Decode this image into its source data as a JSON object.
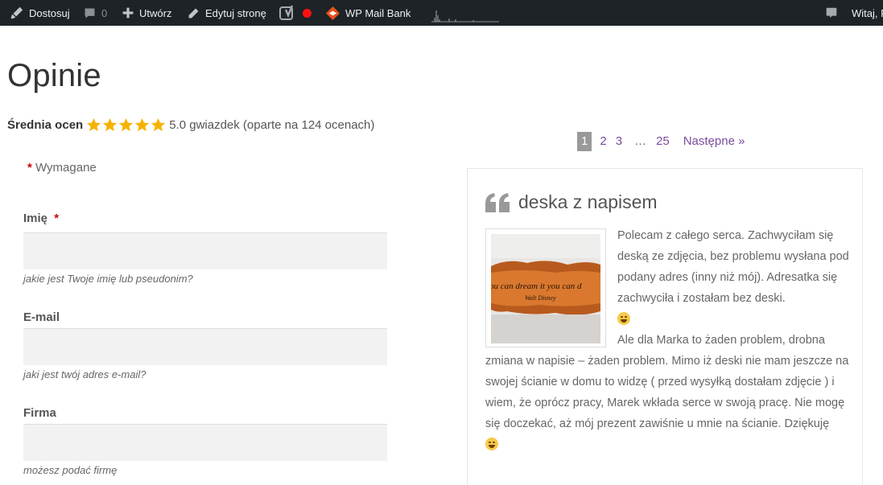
{
  "adminbar": {
    "customize_label": "Dostosuj",
    "comments_count": "0",
    "new_label": "Utwórz",
    "edit_label": "Edytuj stronę",
    "plugin_label": "WP Mail Bank",
    "greeting": "Witaj, F"
  },
  "page": {
    "title": "Opinie",
    "rating_label": "Średnia ocen",
    "rating_value": 5.0,
    "rating_summary": "5.0 gwiazdek (oparte na 124 ocenach)"
  },
  "form": {
    "required_marker": "*",
    "required_label": "Wymagane",
    "fields": [
      {
        "label": "Imię",
        "required": true,
        "value": "",
        "help": "jakie jest Twoje imię lub pseudonim?"
      },
      {
        "label": "E-mail",
        "required": false,
        "value": "",
        "help": "jaki jest twój adres e-mail?"
      },
      {
        "label": "Firma",
        "required": false,
        "value": "",
        "help": "możesz podać firmę"
      }
    ]
  },
  "pagination": {
    "current": "1",
    "pages": [
      "2",
      "3"
    ],
    "ellipsis": "…",
    "last": "25",
    "next": "Następne »"
  },
  "review": {
    "title": "deska z napisem",
    "image_text": "ou can dream it you can d",
    "paragraph1": "Polecam z całego serca. Zachwyciłam się deską ze zdjęcia, bez problemu wysłana pod podany adres (inny niż mój). Adresatka się zachwyciła i zostałam bez deski.",
    "paragraph2": "Ale dla Marka to żaden problem, drobna zmiana w napisie – żaden problem. Mimo iż deski nie mam jeszcze na swojej ścianie w domu to widzę ( przed wysyłką dostałam zdjęcie ) i wiem, że oprócz pracy, Marek wkłada serce w swoją pracę. Nie mogę się doczekać, aż mój prezent zawiśnie u mnie na ścianie. Dziękuję"
  },
  "colors": {
    "adminbar_bg": "#1d2327",
    "star": "#f5b301",
    "link": "#7b4d9c",
    "required": "#cc0000",
    "record_dot": "#ff1111",
    "plugin_icon": "#e8501a"
  }
}
